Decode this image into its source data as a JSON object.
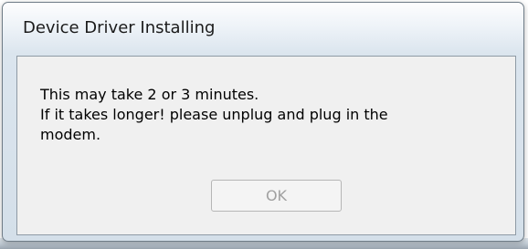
{
  "window": {
    "title": "Device Driver Installing"
  },
  "message": {
    "line1": "This may take 2 or 3 minutes.",
    "line2": "If it takes longer! please unplug and plug in the",
    "line3": "modem."
  },
  "buttons": {
    "ok_label": "OK",
    "ok_state": "disabled"
  },
  "colors": {
    "window_frame": "#dbe5ee",
    "client_background": "#f0f0f0",
    "disabled_text": "#a0a0a0"
  }
}
